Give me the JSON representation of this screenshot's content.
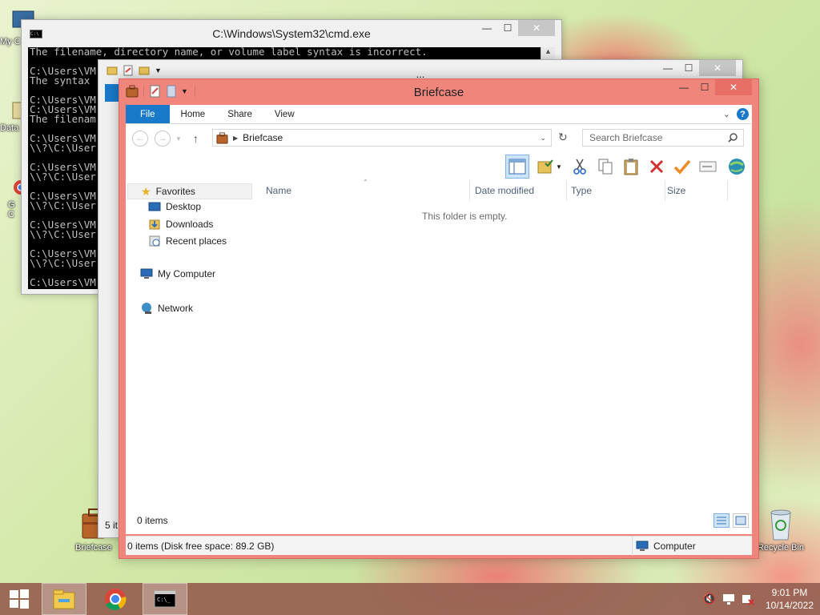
{
  "desktop": {
    "icons": [
      {
        "label": "Briefcase"
      },
      {
        "label": "Recycle Bin"
      }
    ],
    "partial_labels": [
      "My C",
      "Data",
      "G",
      "C"
    ]
  },
  "cmd": {
    "title": "C:\\Windows\\System32\\cmd.exe",
    "lines": [
      "The filename, directory name, or volume label syntax is incorrect.",
      "",
      "C:\\Users\\VM",
      "The syntax",
      "",
      "C:\\Users\\VM",
      "C:\\Users\\VM",
      "The filenam",
      "",
      "C:\\Users\\VM",
      "\\\\?\\C:\\User",
      "",
      "C:\\Users\\VM",
      "\\\\?\\C:\\User",
      "",
      "C:\\Users\\VM",
      "\\\\?\\C:\\User",
      "",
      "C:\\Users\\VM",
      "\\\\?\\C:\\User",
      "",
      "C:\\Users\\VM",
      "\\\\?\\C:\\User",
      "",
      "C:\\Users\\VM"
    ]
  },
  "back_explorer": {
    "title": "...",
    "status_partial": "5 it"
  },
  "explorer": {
    "title": "Briefcase",
    "tabs": [
      "File",
      "Home",
      "Share",
      "View"
    ],
    "address": {
      "crumb": "Briefcase"
    },
    "search": {
      "placeholder": "Search Briefcase"
    },
    "nav": {
      "favorites": "Favorites",
      "desktop": "Desktop",
      "downloads": "Downloads",
      "recent": "Recent places",
      "computer": "My Computer",
      "network": "Network"
    },
    "columns": [
      "Name",
      "Date modified",
      "Type",
      "Size"
    ],
    "empty_message": "This folder is empty.",
    "item_count": "0 items",
    "status": {
      "left": "0 items (Disk free space: 89.2 GB)",
      "right": "Computer"
    }
  },
  "taskbar": {
    "time": "9:01 PM",
    "date": "10/14/2022"
  }
}
